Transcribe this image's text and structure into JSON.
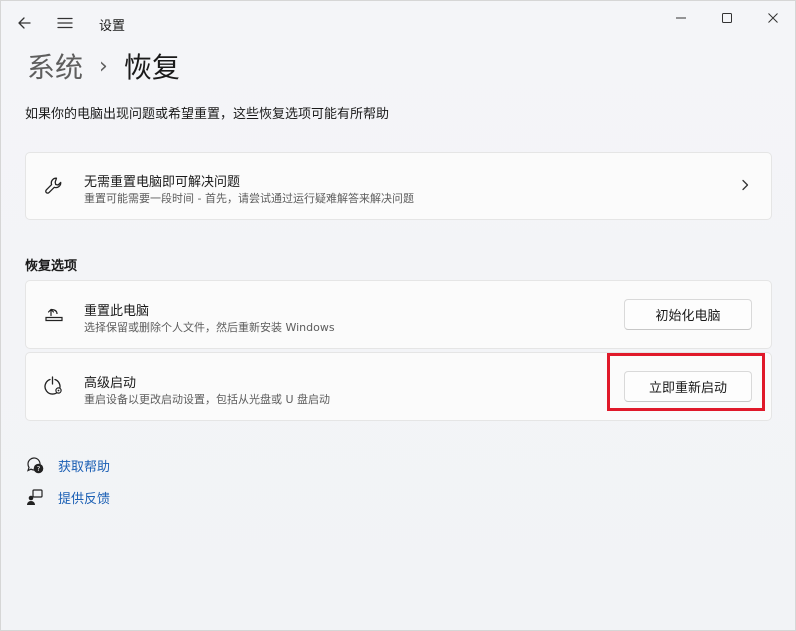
{
  "window": {
    "title": "设置",
    "controls": [
      "minimize",
      "maximize",
      "close"
    ]
  },
  "breadcrumb": {
    "parent": "系统",
    "separator": "›",
    "current": "恢复"
  },
  "page_description": "如果你的电脑出现问题或希望重置，这些恢复选项可能有所帮助",
  "fix_card": {
    "title": "无需重置电脑即可解决问题",
    "subtitle": "重置可能需要一段时间 - 首先，请尝试通过运行疑难解答来解决问题",
    "icon": "wrench-icon"
  },
  "recovery_options": {
    "heading": "恢复选项",
    "items": [
      {
        "title": "重置此电脑",
        "subtitle": "选择保留或删除个人文件，然后重新安装 Windows",
        "button": "初始化电脑",
        "icon": "reset-pc-icon"
      },
      {
        "title": "高级启动",
        "subtitle": "重启设备以更改启动设置，包括从光盘或 U 盘启动",
        "button": "立即重新启动",
        "icon": "advanced-startup-icon"
      }
    ]
  },
  "links": {
    "help": "获取帮助",
    "feedback": "提供反馈"
  },
  "colors": {
    "accent_link": "#1a5fb4",
    "highlight_border": "#e0192a",
    "background": "#f3f3f3"
  }
}
